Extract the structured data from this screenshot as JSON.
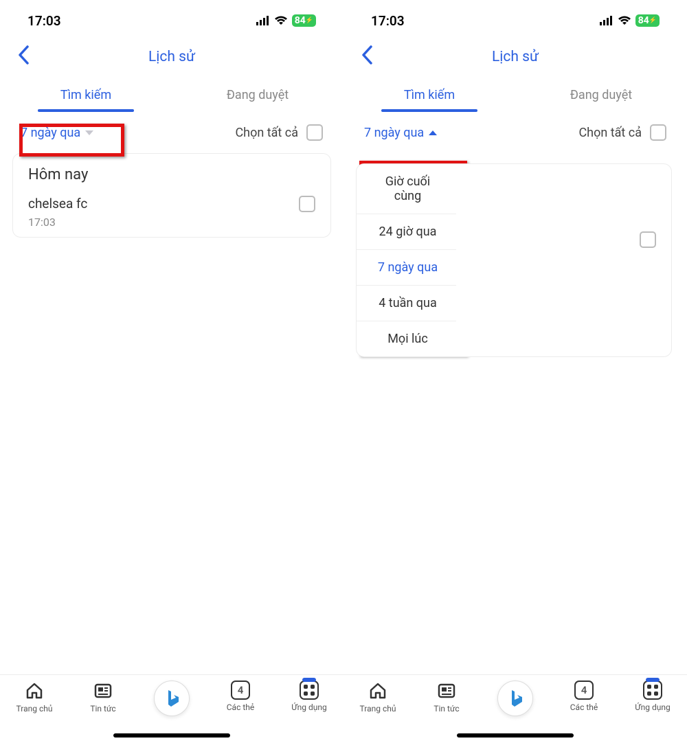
{
  "statusBar": {
    "time": "17:03",
    "battery": "84"
  },
  "header": {
    "title": "Lịch sử"
  },
  "tabs": {
    "search": "Tìm kiếm",
    "browsing": "Đang duyệt"
  },
  "filter": {
    "label": "7 ngày qua",
    "selectAll": "Chọn tất cả"
  },
  "card": {
    "dayLabel": "Hôm nay",
    "item": {
      "text": "chelsea fc",
      "time": "17:03"
    }
  },
  "dropdown": {
    "options": [
      "Giờ cuối cùng",
      "24 giờ qua",
      "7 ngày qua",
      "4 tuần qua",
      "Mọi lúc"
    ],
    "selectedIndex": 2
  },
  "bottomNav": {
    "home": "Trang chủ",
    "news": "Tin tức",
    "tabsLabel": "Các thẻ",
    "tabsCount": "4",
    "apps": "Ứng dụng"
  }
}
